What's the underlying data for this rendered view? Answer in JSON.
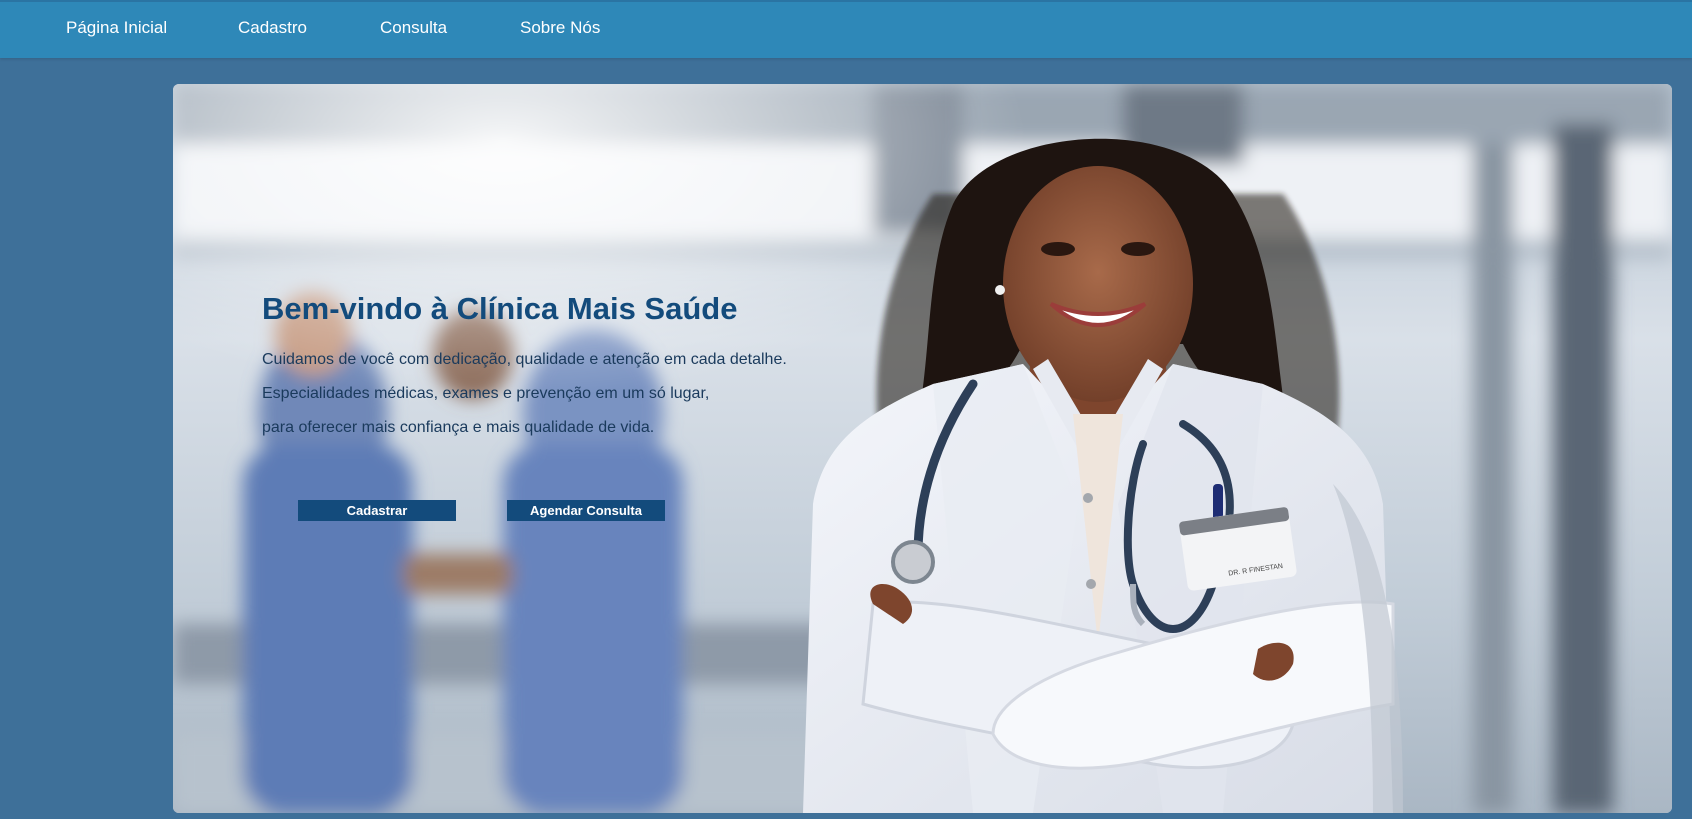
{
  "nav": {
    "items": [
      {
        "label": "Página Inicial"
      },
      {
        "label": "Cadastro"
      },
      {
        "label": "Consulta"
      },
      {
        "label": "Sobre Nós"
      }
    ]
  },
  "hero": {
    "title": "Bem-vindo à Clínica Mais Saúde",
    "lines": [
      "Cuidamos de você com dedicação, qualidade e atenção em cada detalhe.",
      "Especialidades médicas, exames e prevenção em um só lugar,",
      "para oferecer mais confiança e mais qualidade de vida."
    ],
    "buttons": {
      "register": "Cadastrar",
      "schedule": "Agendar Consulta"
    },
    "image": "doctor-photo",
    "badge_text": "DR. R FINESTAN"
  },
  "colors": {
    "navbar": "#2e88b8",
    "page_background": "#3e7099",
    "title": "#134b7c",
    "button": "#134b7c"
  }
}
